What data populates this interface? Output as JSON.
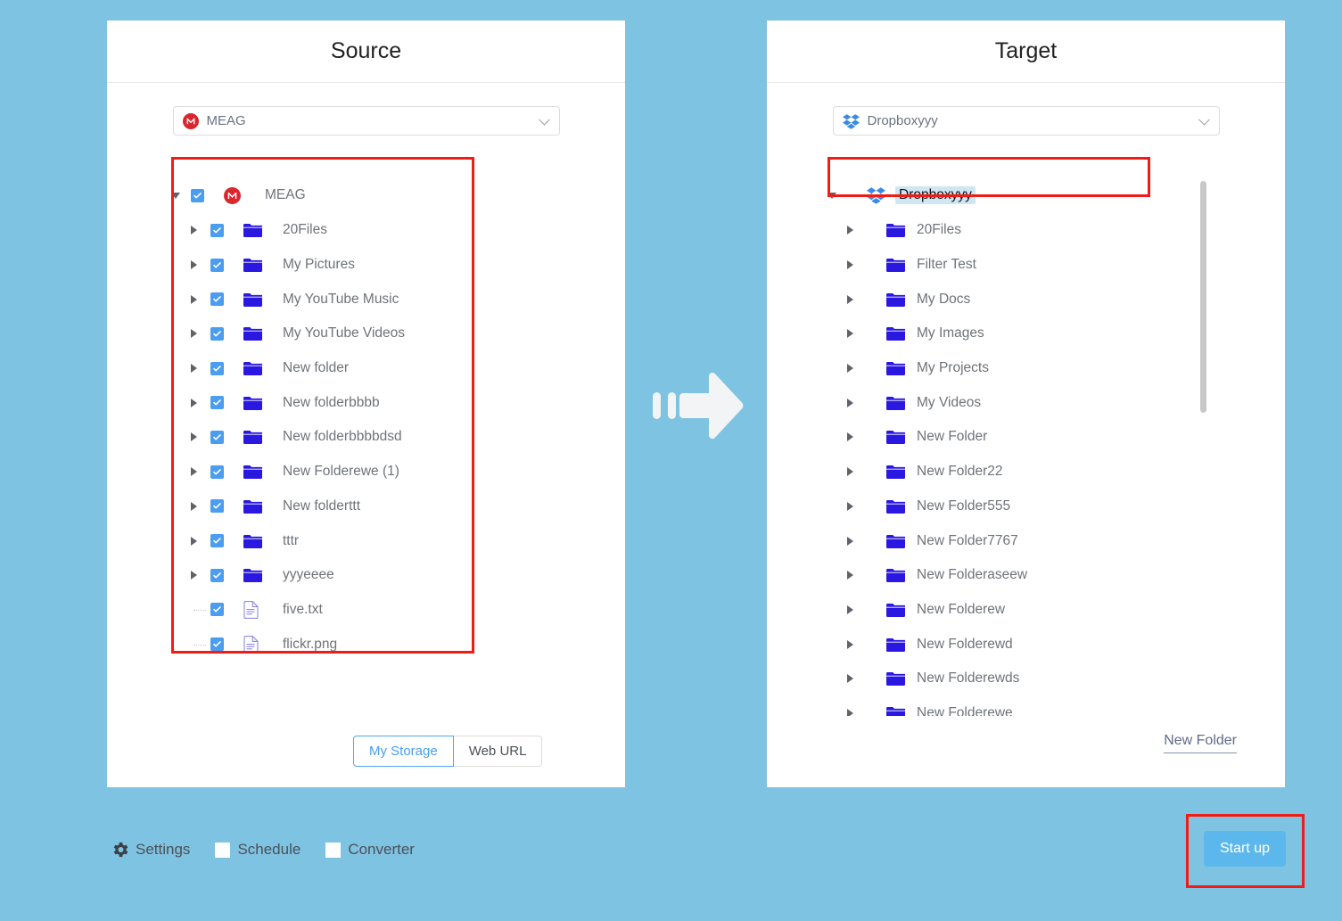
{
  "theme": {
    "background": "#7fc3e2",
    "panel_bg": "#ffffff",
    "accent_blue": "#4a9df0",
    "annotation_red": "#f01c15",
    "mega_red": "#d9272e",
    "dropbox_blue": "#2d7ff0",
    "folder_blue": "#2a18e0",
    "startup_blue": "#5cb8ec"
  },
  "source": {
    "title": "Source",
    "account": {
      "name": "MEAG",
      "icon": "mega-icon"
    },
    "tree": {
      "root": {
        "label": "MEAG",
        "icon": "mega-icon",
        "expanded": true,
        "checked": true
      },
      "children": [
        {
          "label": "20Files",
          "type": "folder",
          "checked": true,
          "expanded": false
        },
        {
          "label": "My Pictures",
          "type": "folder",
          "checked": true,
          "expanded": false
        },
        {
          "label": "My YouTube Music",
          "type": "folder",
          "checked": true,
          "expanded": false
        },
        {
          "label": "My YouTube Videos",
          "type": "folder",
          "checked": true,
          "expanded": false
        },
        {
          "label": "New folder",
          "type": "folder",
          "checked": true,
          "expanded": false
        },
        {
          "label": "New folderbbbb",
          "type": "folder",
          "checked": true,
          "expanded": false
        },
        {
          "label": "New folderbbbbdsd",
          "type": "folder",
          "checked": true,
          "expanded": false
        },
        {
          "label": "New Folderewe (1)",
          "type": "folder",
          "checked": true,
          "expanded": false
        },
        {
          "label": "New folderttt",
          "type": "folder",
          "checked": true,
          "expanded": false
        },
        {
          "label": "tttr",
          "type": "folder",
          "checked": true,
          "expanded": false
        },
        {
          "label": "yyyeeee",
          "type": "folder",
          "checked": true,
          "expanded": false
        },
        {
          "label": "five.txt",
          "type": "file",
          "checked": true
        },
        {
          "label": "flickr.png",
          "type": "file",
          "checked": true
        }
      ]
    },
    "storage_toggle": {
      "options": [
        "My Storage",
        "Web URL"
      ],
      "selected": "My Storage"
    }
  },
  "target": {
    "title": "Target",
    "account": {
      "name": "Dropboxyyy",
      "icon": "dropbox-icon"
    },
    "tree": {
      "root": {
        "label": "Dropboxyyy",
        "icon": "dropbox-icon",
        "expanded": true,
        "selected": true
      },
      "children": [
        {
          "label": "20Files",
          "type": "folder",
          "expanded": false
        },
        {
          "label": "Filter Test",
          "type": "folder",
          "expanded": false
        },
        {
          "label": "My Docs",
          "type": "folder",
          "expanded": false
        },
        {
          "label": "My Images",
          "type": "folder",
          "expanded": false
        },
        {
          "label": "My Projects",
          "type": "folder",
          "expanded": false
        },
        {
          "label": "My Videos",
          "type": "folder",
          "expanded": false
        },
        {
          "label": "New Folder",
          "type": "folder",
          "expanded": false
        },
        {
          "label": "New Folder22",
          "type": "folder",
          "expanded": false
        },
        {
          "label": "New Folder555",
          "type": "folder",
          "expanded": false
        },
        {
          "label": "New Folder7767",
          "type": "folder",
          "expanded": false
        },
        {
          "label": "New Folderaseew",
          "type": "folder",
          "expanded": false
        },
        {
          "label": "New Folderew",
          "type": "folder",
          "expanded": false
        },
        {
          "label": "New Folderewd",
          "type": "folder",
          "expanded": false
        },
        {
          "label": "New Folderewds",
          "type": "folder",
          "expanded": false
        },
        {
          "label": "New Folderewe",
          "type": "folder",
          "expanded": false
        }
      ]
    },
    "new_folder_label": "New Folder"
  },
  "transfer_arrow": {
    "icon": "right-arrow-icon"
  },
  "footer": {
    "settings_label": "Settings",
    "settings_icon": "gear-icon",
    "schedule_label": "Schedule",
    "schedule_checked": false,
    "converter_label": "Converter",
    "converter_checked": false,
    "startup_label": "Start up"
  }
}
